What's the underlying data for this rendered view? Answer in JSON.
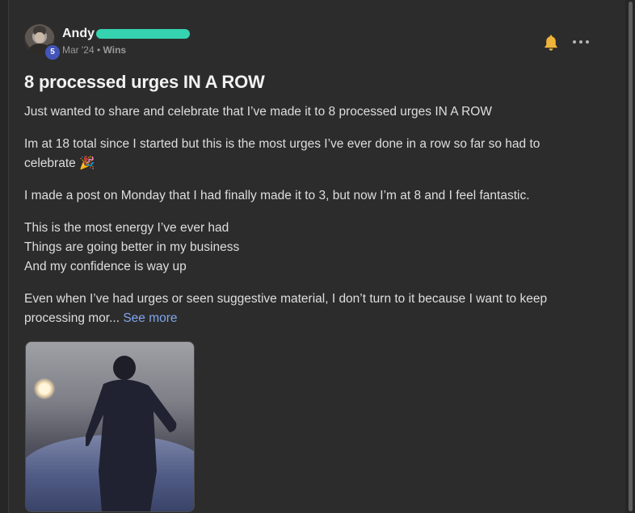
{
  "post": {
    "author": "Andy",
    "level": "5",
    "date": "Mar '24",
    "separator": "•",
    "category": "Wins",
    "title": "8 processed urges IN A ROW",
    "paragraphs": [
      "Just wanted to share and celebrate that I’ve made it to 8 processed urges IN A ROW",
      "Im at 18 total since I started but this is the most urges I’ve ever done in a row so far so had to celebrate 🎉",
      "I made a post on Monday that I had finally made it to 3, but now I’m at 8 and I feel fantastic."
    ],
    "lines": [
      "This is the most energy I’ve ever had",
      "Things are going better in my business",
      "And my confidence is way up"
    ],
    "last_paragraph": "Even when I’ve had urges or seen suggestive material, I don’t turn to it because I want to keep processing mor...",
    "see_more": "See more"
  },
  "icons": {
    "bell": "bell-icon",
    "more": "more-options-icon"
  },
  "colors": {
    "background": "#2c2c2c",
    "accent_link": "#7fa5ee",
    "redaction": "#35d3b0",
    "level_badge": "#4355b8",
    "bell": "#f0b43a"
  }
}
